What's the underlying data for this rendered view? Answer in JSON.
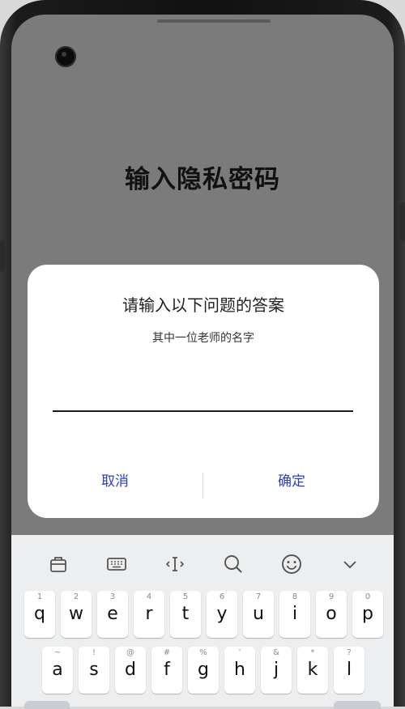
{
  "page": {
    "title": "输入隐私密码"
  },
  "dialog": {
    "title": "请输入以下问题的答案",
    "question": "其中一位老师的名字",
    "answer_value": "",
    "cancel_label": "取消",
    "confirm_label": "确定"
  },
  "keyboard": {
    "toolbar": [
      "clipboard-icon",
      "keyboard-icon",
      "text-cursor-icon",
      "search-icon",
      "emoji-icon",
      "chevron-down-icon"
    ],
    "row1": [
      {
        "hint": "1",
        "key": "q"
      },
      {
        "hint": "2",
        "key": "w"
      },
      {
        "hint": "3",
        "key": "e"
      },
      {
        "hint": "4",
        "key": "r"
      },
      {
        "hint": "5",
        "key": "t"
      },
      {
        "hint": "6",
        "key": "y"
      },
      {
        "hint": "7",
        "key": "u"
      },
      {
        "hint": "8",
        "key": "i"
      },
      {
        "hint": "9",
        "key": "o"
      },
      {
        "hint": "0",
        "key": "p"
      }
    ],
    "row2": [
      {
        "hint": "~",
        "key": "a"
      },
      {
        "hint": "!",
        "key": "s"
      },
      {
        "hint": "@",
        "key": "d"
      },
      {
        "hint": "#",
        "key": "f"
      },
      {
        "hint": "%",
        "key": "g"
      },
      {
        "hint": "'",
        "key": "h"
      },
      {
        "hint": "&",
        "key": "j"
      },
      {
        "hint": "*",
        "key": "k"
      },
      {
        "hint": "?",
        "key": "l"
      }
    ]
  },
  "colors": {
    "accent": "#2a3fc0",
    "screen_dim": "#7b7b7b",
    "dialog_bg": "#ffffff",
    "keyboard_bg": "#eceef0"
  }
}
